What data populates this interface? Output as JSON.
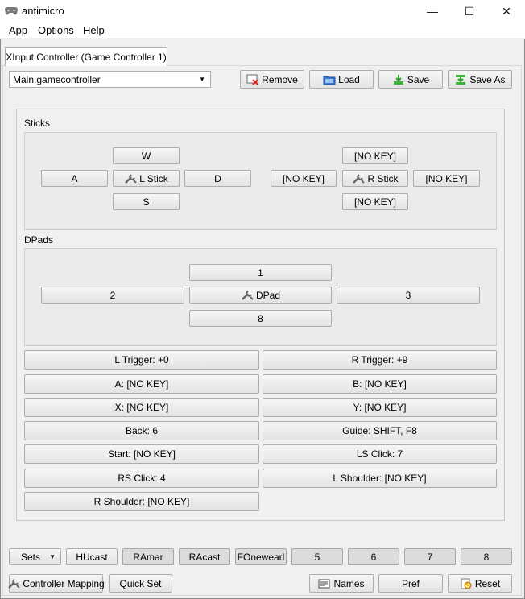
{
  "window": {
    "title": "antimicro",
    "minimize": "—",
    "maximize": "☐",
    "close": "✕"
  },
  "menu": {
    "app": "App",
    "options": "Options",
    "help": "Help"
  },
  "tab": {
    "label": "XInput Controller (Game Controller 1)"
  },
  "profile": {
    "selected": "Main.gamecontroller"
  },
  "toolbar": {
    "remove": "Remove",
    "load": "Load",
    "save": "Save",
    "save_as": "Save As"
  },
  "sticks": {
    "title": "Sticks",
    "left": {
      "up": "W",
      "left": "A",
      "center": "L Stick",
      "right": "D",
      "down": "S"
    },
    "right": {
      "up": "[NO KEY]",
      "left": "[NO KEY]",
      "center": "R Stick",
      "right": "[NO KEY]",
      "down": "[NO KEY]"
    }
  },
  "dpads": {
    "title": "DPads",
    "up": "1",
    "left": "2",
    "center": "DPad",
    "right": "3",
    "down": "8"
  },
  "buttons": [
    "L Trigger: +0",
    "R Trigger: +9",
    "A: [NO KEY]",
    "B: [NO KEY]",
    "X: [NO KEY]",
    "Y: [NO KEY]",
    "Back: 6",
    "Guide: SHIFT, F8",
    "Start: [NO KEY]",
    "LS Click: 7",
    "RS Click: 4",
    "L Shoulder: [NO KEY]",
    "R Shoulder: [NO KEY]"
  ],
  "sets": {
    "label": "Sets",
    "items": [
      "HUcast",
      "RAmar",
      "RAcast",
      "FOnewearl",
      "5",
      "6",
      "7",
      "8"
    ]
  },
  "bottom": {
    "controller_mapping": "Controller Mapping",
    "quick_set": "Quick Set",
    "names": "Names",
    "pref": "Pref",
    "reset": "Reset"
  }
}
